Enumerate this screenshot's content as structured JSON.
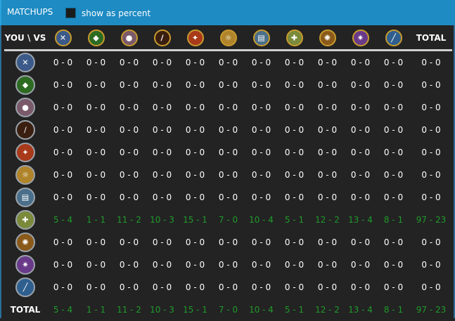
{
  "header": {
    "title": "MATCHUPS",
    "checkbox_label": "show as percent"
  },
  "table": {
    "corner_label": "YOU \\ VS",
    "total_label": "TOTAL",
    "classes": [
      {
        "icon": "crossed-swords-icon",
        "color": "#3b5a8a",
        "glyph": "✕"
      },
      {
        "icon": "green-claw-icon",
        "color": "#2d6b22",
        "glyph": "◆"
      },
      {
        "icon": "beast-head-icon",
        "color": "#7a5a6a",
        "glyph": "●"
      },
      {
        "icon": "fire-scythe-icon",
        "color": "#3a1f10",
        "glyph": "/"
      },
      {
        "icon": "flame-strike-icon",
        "color": "#a83a1a",
        "glyph": "✦"
      },
      {
        "icon": "golden-hand-icon",
        "color": "#b0842a",
        "glyph": "☼"
      },
      {
        "icon": "frost-book-icon",
        "color": "#4a6f8a",
        "glyph": "▤"
      },
      {
        "icon": "nature-wings-icon",
        "color": "#7a8a3a",
        "glyph": "✚"
      },
      {
        "icon": "golden-beast-icon",
        "color": "#8a5a1a",
        "glyph": "✺"
      },
      {
        "icon": "arcane-star-icon",
        "color": "#6a3a8a",
        "glyph": "✷"
      },
      {
        "icon": "blue-blade-icon",
        "color": "#2f5f8f",
        "glyph": "╱"
      }
    ],
    "rows": [
      {
        "highlight": false,
        "values": [
          "0 - 0",
          "0 - 0",
          "0 - 0",
          "0 - 0",
          "0 - 0",
          "0 - 0",
          "0 - 0",
          "0 - 0",
          "0 - 0",
          "0 - 0",
          "0 - 0"
        ],
        "total": "0 - 0"
      },
      {
        "highlight": false,
        "values": [
          "0 - 0",
          "0 - 0",
          "0 - 0",
          "0 - 0",
          "0 - 0",
          "0 - 0",
          "0 - 0",
          "0 - 0",
          "0 - 0",
          "0 - 0",
          "0 - 0"
        ],
        "total": "0 - 0"
      },
      {
        "highlight": false,
        "values": [
          "0 - 0",
          "0 - 0",
          "0 - 0",
          "0 - 0",
          "0 - 0",
          "0 - 0",
          "0 - 0",
          "0 - 0",
          "0 - 0",
          "0 - 0",
          "0 - 0"
        ],
        "total": "0 - 0"
      },
      {
        "highlight": false,
        "values": [
          "0 - 0",
          "0 - 0",
          "0 - 0",
          "0 - 0",
          "0 - 0",
          "0 - 0",
          "0 - 0",
          "0 - 0",
          "0 - 0",
          "0 - 0",
          "0 - 0"
        ],
        "total": "0 - 0"
      },
      {
        "highlight": false,
        "values": [
          "0 - 0",
          "0 - 0",
          "0 - 0",
          "0 - 0",
          "0 - 0",
          "0 - 0",
          "0 - 0",
          "0 - 0",
          "0 - 0",
          "0 - 0",
          "0 - 0"
        ],
        "total": "0 - 0"
      },
      {
        "highlight": false,
        "values": [
          "0 - 0",
          "0 - 0",
          "0 - 0",
          "0 - 0",
          "0 - 0",
          "0 - 0",
          "0 - 0",
          "0 - 0",
          "0 - 0",
          "0 - 0",
          "0 - 0"
        ],
        "total": "0 - 0"
      },
      {
        "highlight": false,
        "values": [
          "0 - 0",
          "0 - 0",
          "0 - 0",
          "0 - 0",
          "0 - 0",
          "0 - 0",
          "0 - 0",
          "0 - 0",
          "0 - 0",
          "0 - 0",
          "0 - 0"
        ],
        "total": "0 - 0"
      },
      {
        "highlight": true,
        "values": [
          "5 - 4",
          "1 - 1",
          "11 - 2",
          "10 - 3",
          "15 - 1",
          "7 - 0",
          "10 - 4",
          "5 - 1",
          "12 - 2",
          "13 - 4",
          "8 - 1"
        ],
        "total": "97 - 23"
      },
      {
        "highlight": false,
        "values": [
          "0 - 0",
          "0 - 0",
          "0 - 0",
          "0 - 0",
          "0 - 0",
          "0 - 0",
          "0 - 0",
          "0 - 0",
          "0 - 0",
          "0 - 0",
          "0 - 0"
        ],
        "total": "0 - 0"
      },
      {
        "highlight": false,
        "values": [
          "0 - 0",
          "0 - 0",
          "0 - 0",
          "0 - 0",
          "0 - 0",
          "0 - 0",
          "0 - 0",
          "0 - 0",
          "0 - 0",
          "0 - 0",
          "0 - 0"
        ],
        "total": "0 - 0"
      },
      {
        "highlight": false,
        "values": [
          "0 - 0",
          "0 - 0",
          "0 - 0",
          "0 - 0",
          "0 - 0",
          "0 - 0",
          "0 - 0",
          "0 - 0",
          "0 - 0",
          "0 - 0",
          "0 - 0"
        ],
        "total": "0 - 0"
      }
    ],
    "totals": {
      "values": [
        "5 - 4",
        "1 - 1",
        "11 - 2",
        "10 - 3",
        "15 - 1",
        "7 - 0",
        "10 - 4",
        "5 - 1",
        "12 - 2",
        "13 - 4",
        "8 - 1"
      ],
      "total": "97 - 23"
    },
    "colors": {
      "win_text": "#1f9a2a",
      "header_bar": "#1e8bc3"
    }
  }
}
